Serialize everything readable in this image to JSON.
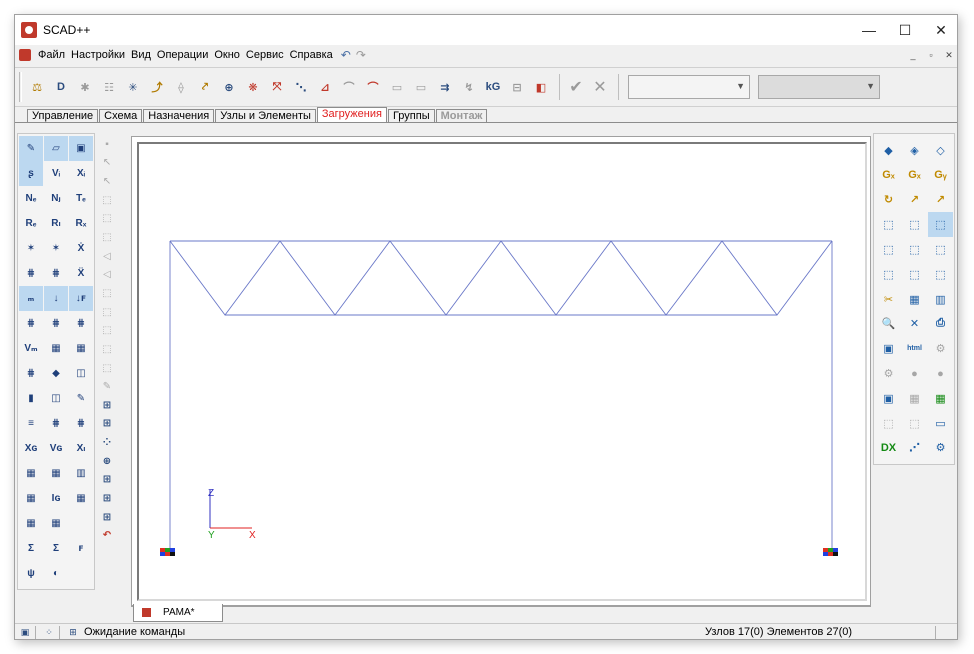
{
  "window": {
    "title": "SCAD++",
    "controls": {
      "minimize": "—",
      "maximize": "☐",
      "close": "✕"
    }
  },
  "menu": {
    "items": [
      "Файл",
      "Настройки",
      "Вид",
      "Операции",
      "Окно",
      "Сервис",
      "Справка"
    ],
    "undo_icon": "↶",
    "redo_icon": "↷",
    "mdi": {
      "minimize": "_",
      "restore": "▫",
      "close": "✕"
    }
  },
  "toolbar": {
    "buttons": [
      "⚖",
      "D",
      "✱",
      "☷",
      "✳",
      "⤴",
      "⟠",
      "⤤",
      "⊕",
      "❋",
      "⤧",
      "⋱",
      "⊿",
      "⌒",
      "⌒",
      "▭",
      "▭",
      "⇉",
      "↯",
      "kG",
      "⊟",
      "◧"
    ],
    "apply_icon": "✔",
    "cancel_icon": "✕",
    "combo1_value": "",
    "combo2_value": ""
  },
  "tabs": [
    {
      "label": "Управление",
      "state": "normal"
    },
    {
      "label": "Схема",
      "state": "normal"
    },
    {
      "label": "Назначения",
      "state": "normal"
    },
    {
      "label": "Узлы и Элементы",
      "state": "normal"
    },
    {
      "label": "Загружения",
      "state": "active"
    },
    {
      "label": "Группы",
      "state": "normal"
    },
    {
      "label": "Монтаж",
      "state": "disabled"
    }
  ],
  "left_panel": {
    "icons": [
      "✎",
      "▱",
      "▣",
      "ʂ",
      "Vᵢ",
      "Xᵢ",
      "Nₑ",
      "Nⱼ",
      "Tₑ",
      "Rₑ",
      "Rₗ",
      "Rₓ",
      "✶",
      "✶",
      "Ẋ",
      "⋕",
      "⋕",
      "Ẍ",
      "ₘ",
      "↓",
      "↓ꜰ",
      "⋕",
      "⋕",
      "⋕",
      "Vₘ",
      "▦",
      "▦",
      "⋕",
      "◆",
      "◫",
      "▮",
      "◫",
      "✎",
      "≡",
      "⋕",
      "⋕",
      "Xɢ",
      "Vɢ",
      "Xₗ",
      "▦",
      "▦",
      "▥",
      "▦",
      "Iɢ",
      "▦",
      "▦",
      "▦",
      "",
      "Σ",
      "Σ",
      "ꜰ",
      "ψ",
      "◐",
      ""
    ]
  },
  "vertical_tools": [
    "▪",
    "↖",
    "↖",
    "⬚",
    "⬚",
    "⬚",
    "◁",
    "◁",
    "⬚",
    "⬚",
    "⬚",
    "⬚",
    "⬚",
    "✎",
    "⊞",
    "⊞",
    "⁘",
    "⊕",
    "⊞",
    "⊞",
    "⊞",
    "↶"
  ],
  "right_panel": {
    "icons": [
      "◆",
      "◈",
      "◇",
      "Gₓ",
      "Gₓ",
      "Gᵧ",
      "↻",
      "↗",
      "↗",
      "⬚",
      "⬚",
      "⬚",
      "⬚",
      "⬚",
      "⬚",
      "⬚",
      "⬚",
      "⬚",
      "✂",
      "▦",
      "▥",
      "🔍",
      "✕",
      "⎙",
      "▣",
      "html",
      "⚙",
      "⚙",
      "●",
      "●",
      "▣",
      "▦",
      "▦",
      "⬚",
      "⬚",
      "▭",
      "DX",
      "⋰",
      "⚙"
    ]
  },
  "canvas": {
    "axis_z": "Z",
    "axis_y": "Y",
    "axis_x": "X"
  },
  "doc_tab": {
    "label": "РАМА*"
  },
  "statusbar": {
    "message": "Ожидание команды",
    "info": "Узлов 17(0) Элементов 27(0)"
  }
}
